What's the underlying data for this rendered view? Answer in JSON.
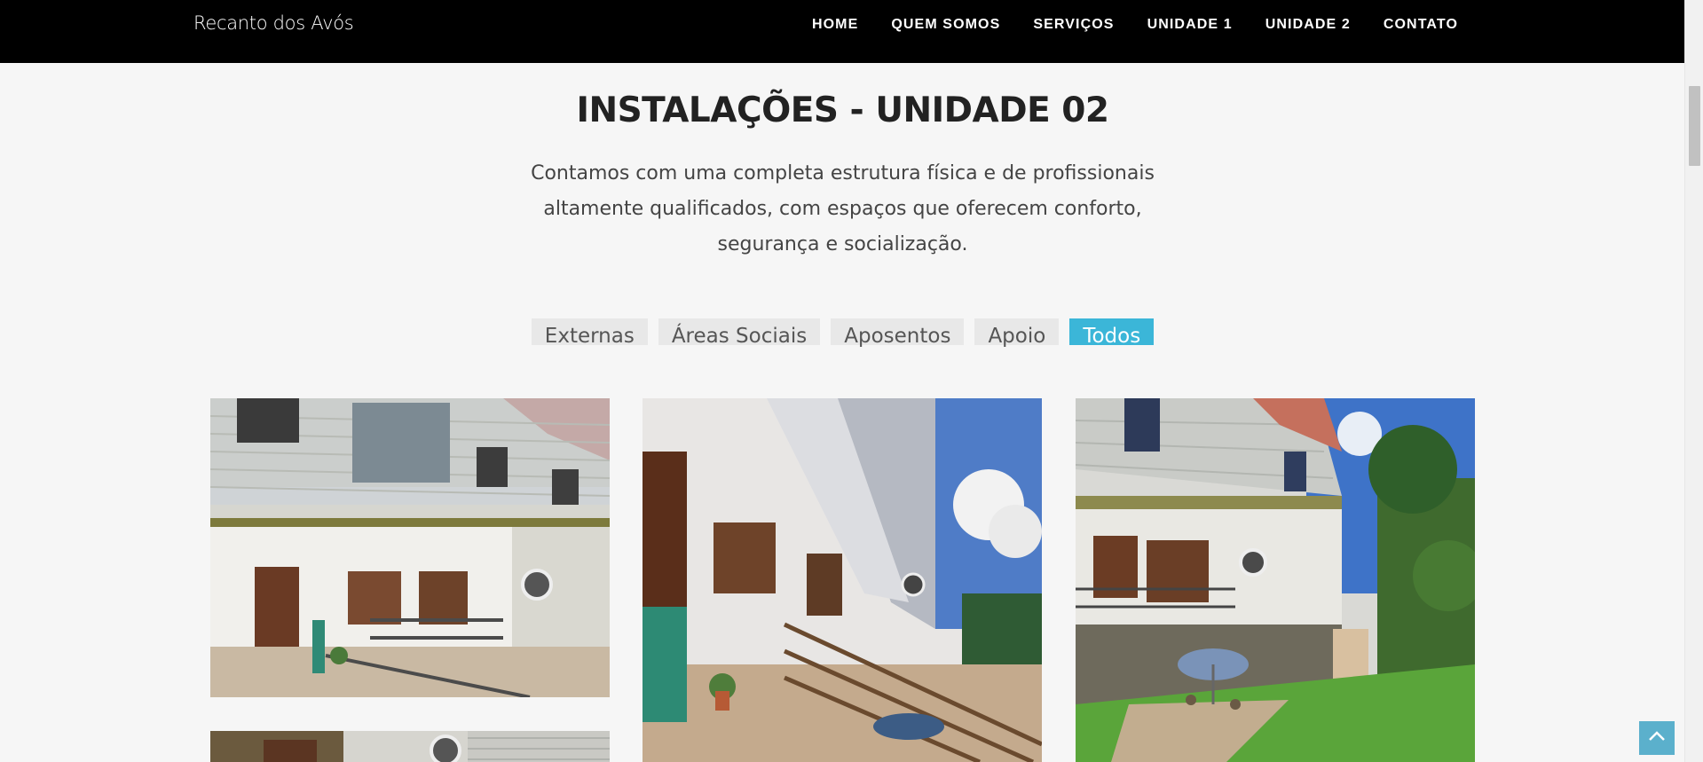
{
  "brand": "Recanto dos Avós",
  "nav": {
    "items": [
      "HOME",
      "QUEM SOMOS",
      "SERVIÇOS",
      "UNIDADE 1",
      "UNIDADE 2",
      "CONTATO"
    ]
  },
  "section": {
    "title": "INSTALAÇÕES - UNIDADE 02",
    "intro": "Contamos com uma completa estrutura física e de profissionais altamente qualificados, com espaços que oferecem conforto, segurança e socialização."
  },
  "filters": {
    "items": [
      "Externas",
      "Áreas Sociais",
      "Aposentos",
      "Apoio",
      "Todos"
    ],
    "active": "Todos"
  },
  "colors": {
    "accent": "#3bb6d8",
    "navbar": "#000000",
    "background": "#f6f6f6"
  },
  "icons": {
    "back_to_top": "chevron-up-icon"
  }
}
